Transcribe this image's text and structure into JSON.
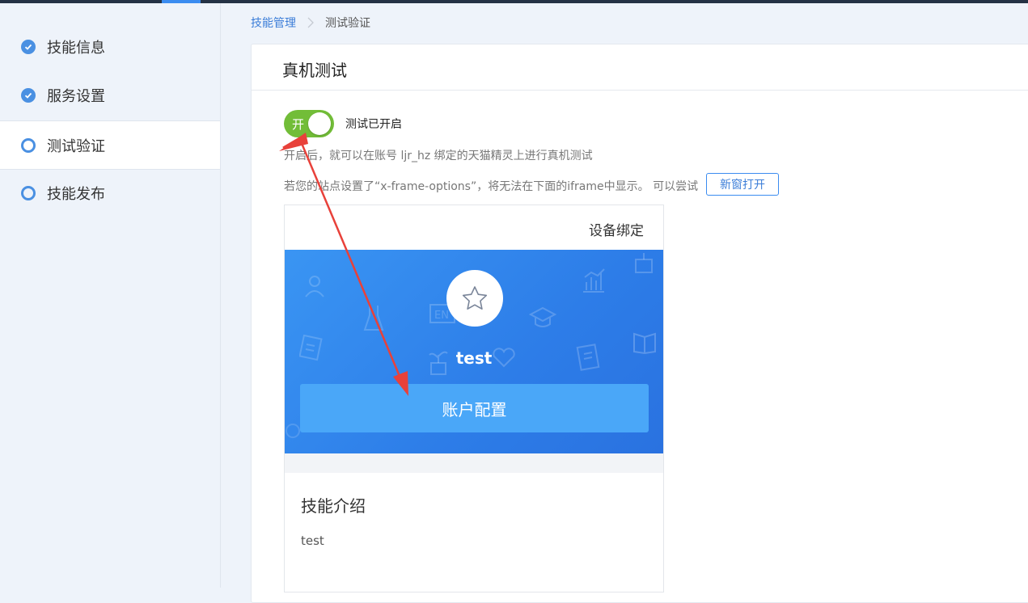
{
  "sidebar": {
    "items": [
      {
        "label": "技能信息",
        "state": "done"
      },
      {
        "label": "服务设置",
        "state": "done"
      },
      {
        "label": "测试验证",
        "state": "active"
      },
      {
        "label": "技能发布",
        "state": "pending"
      }
    ]
  },
  "breadcrumb": {
    "parent": "技能管理",
    "current": "测试验证"
  },
  "card": {
    "title": "真机测试",
    "switch": {
      "on_label": "开",
      "status": "测试已开启"
    },
    "hint_enabled": "开启后，就可以在账号 ljr_hz 绑定的天猫精灵上进行真机测试",
    "hint_iframe": "若您的站点设置了“x-frame-options”，将无法在下面的iframe中显示。 可以尝试",
    "open_new_window": "新窗打开"
  },
  "preview": {
    "bind_device": "设备绑定",
    "skill_name": "test",
    "account_config": "账户配置",
    "intro_title": "技能介绍",
    "intro_text": "test"
  },
  "colors": {
    "accent": "#3b8cf0",
    "switch_on": "#72bd38",
    "banner": "#2d7de8",
    "annotation_arrow": "#e8413a"
  }
}
